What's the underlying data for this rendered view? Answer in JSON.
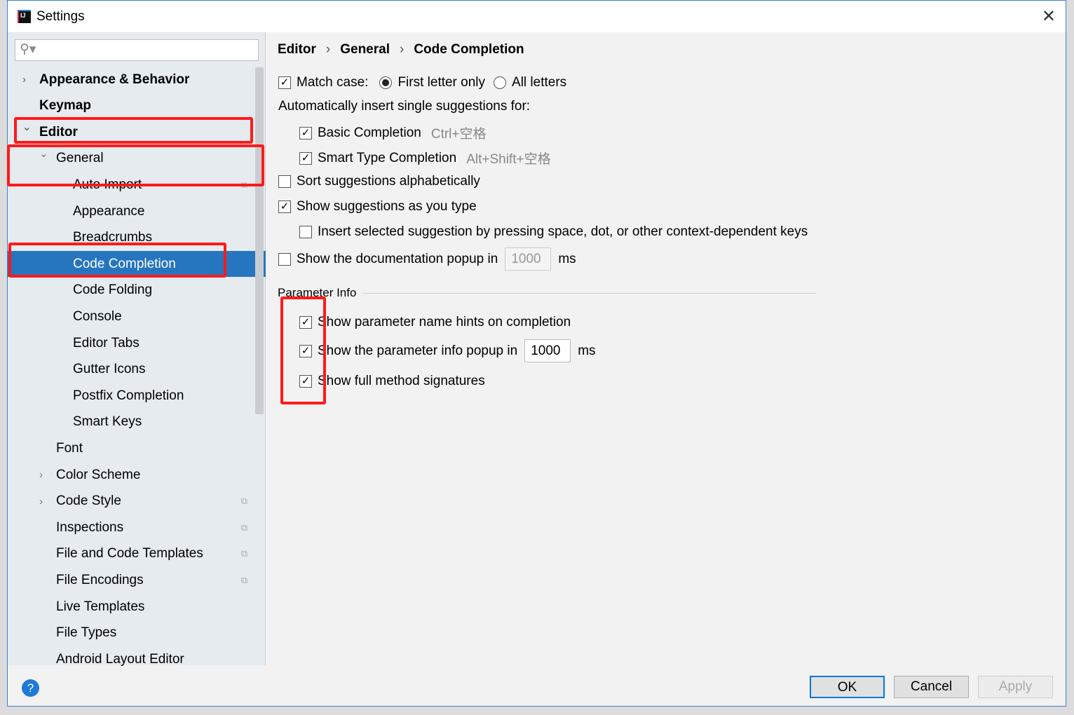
{
  "window": {
    "title": "Settings"
  },
  "search": {
    "placeholder": ""
  },
  "sidebar": {
    "items": [
      {
        "label": "Appearance & Behavior",
        "level": 0,
        "bold": true,
        "arrow": "right"
      },
      {
        "label": "Keymap",
        "level": 0,
        "bold": true
      },
      {
        "label": "Editor",
        "level": 0,
        "bold": true,
        "arrow": "down"
      },
      {
        "label": "General",
        "level": 1,
        "arrow": "down"
      },
      {
        "label": "Auto Import",
        "level": 2,
        "copy": true
      },
      {
        "label": "Appearance",
        "level": 2
      },
      {
        "label": "Breadcrumbs",
        "level": 2
      },
      {
        "label": "Code Completion",
        "level": 2,
        "selected": true
      },
      {
        "label": "Code Folding",
        "level": 2
      },
      {
        "label": "Console",
        "level": 2
      },
      {
        "label": "Editor Tabs",
        "level": 2
      },
      {
        "label": "Gutter Icons",
        "level": 2
      },
      {
        "label": "Postfix Completion",
        "level": 2
      },
      {
        "label": "Smart Keys",
        "level": 2
      },
      {
        "label": "Font",
        "level": 1
      },
      {
        "label": "Color Scheme",
        "level": 1,
        "arrow": "right"
      },
      {
        "label": "Code Style",
        "level": 1,
        "arrow": "right",
        "copy": true
      },
      {
        "label": "Inspections",
        "level": 1,
        "copy": true
      },
      {
        "label": "File and Code Templates",
        "level": 1,
        "copy": true
      },
      {
        "label": "File Encodings",
        "level": 1,
        "copy": true
      },
      {
        "label": "Live Templates",
        "level": 1
      },
      {
        "label": "File Types",
        "level": 1
      },
      {
        "label": "Android Layout Editor",
        "level": 1
      }
    ]
  },
  "breadcrumb": [
    "Editor",
    "General",
    "Code Completion"
  ],
  "main": {
    "match_case": {
      "label": "Match case:",
      "checked": true,
      "options": [
        "First letter only",
        "All letters"
      ],
      "selected": "First letter only"
    },
    "auto_insert_label": "Automatically insert single suggestions for:",
    "basic": {
      "label": "Basic Completion",
      "shortcut": "Ctrl+空格",
      "checked": true
    },
    "smart": {
      "label": "Smart Type Completion",
      "shortcut": "Alt+Shift+空格",
      "checked": true
    },
    "sort": {
      "label": "Sort suggestions alphabetically",
      "checked": false
    },
    "show_typing": {
      "label": "Show suggestions as you type",
      "checked": true
    },
    "insert_selected": {
      "label": "Insert selected suggestion by pressing space, dot, or other context-dependent keys",
      "checked": false
    },
    "doc_popup": {
      "label": "Show the documentation popup in",
      "value": "1000",
      "unit": "ms",
      "checked": false
    },
    "param_section": "Parameter Info",
    "param_hints": {
      "label": "Show parameter name hints on completion",
      "checked": true
    },
    "param_popup": {
      "label": "Show the parameter info popup in",
      "value": "1000",
      "unit": "ms",
      "checked": true
    },
    "full_sig": {
      "label": "Show full method signatures",
      "checked": true
    }
  },
  "footer": {
    "help": "?",
    "ok": "OK",
    "cancel": "Cancel",
    "apply": "Apply"
  },
  "colors": {
    "selection": "#2675bf",
    "annotation": "#ff1a1a",
    "sidebar": "#e6ebf0"
  }
}
